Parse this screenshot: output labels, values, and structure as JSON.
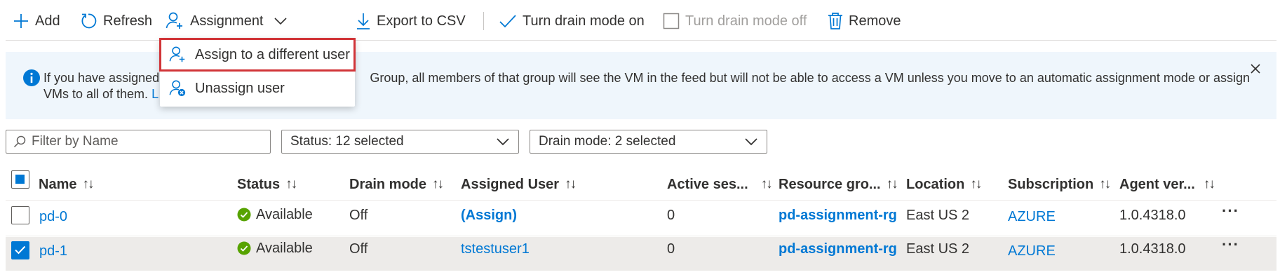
{
  "toolbar": {
    "add": "Add",
    "refresh": "Refresh",
    "assignment": "Assignment",
    "export": "Export to CSV",
    "drain_on": "Turn drain mode on",
    "drain_off": "Turn drain mode off",
    "remove": "Remove"
  },
  "menu": {
    "assign_different": "Assign to a different user",
    "unassign": "Unassign user"
  },
  "info": {
    "line1_start": "If you have assigned",
    "line1_end": "Group, all members of that group will see the VM in the feed but will not be able to access a VM unless you move to an automatic assignment mode or assign",
    "line2_start": "VMs to all of them.",
    "line2_link": "L"
  },
  "filters": {
    "name_placeholder": "Filter by Name",
    "status": "Status: 12 selected",
    "drain": "Drain mode: 2 selected"
  },
  "columns": {
    "name": "Name",
    "status": "Status",
    "drain": "Drain mode",
    "user": "Assigned User",
    "sessions": "Active ses...",
    "rg": "Resource gro...",
    "location": "Location",
    "subscription": "Subscription",
    "agent": "Agent ver..."
  },
  "rows": [
    {
      "name": "pd-0",
      "status": "Available",
      "drain": "Off",
      "user": "(Assign)",
      "sessions": "0",
      "rg": "pd-assignment-rg",
      "location": "East US 2",
      "subscription": "AZURE",
      "agent": "1.0.4318.0",
      "selected": false
    },
    {
      "name": "pd-1",
      "status": "Available",
      "drain": "Off",
      "user": "tstestuser1",
      "sessions": "0",
      "rg": "pd-assignment-rg",
      "location": "East US 2",
      "subscription": "AZURE",
      "agent": "1.0.4318.0",
      "selected": true
    }
  ],
  "colors": {
    "accent": "#0078d4",
    "success": "#57a300",
    "highlight": "#d13438"
  }
}
